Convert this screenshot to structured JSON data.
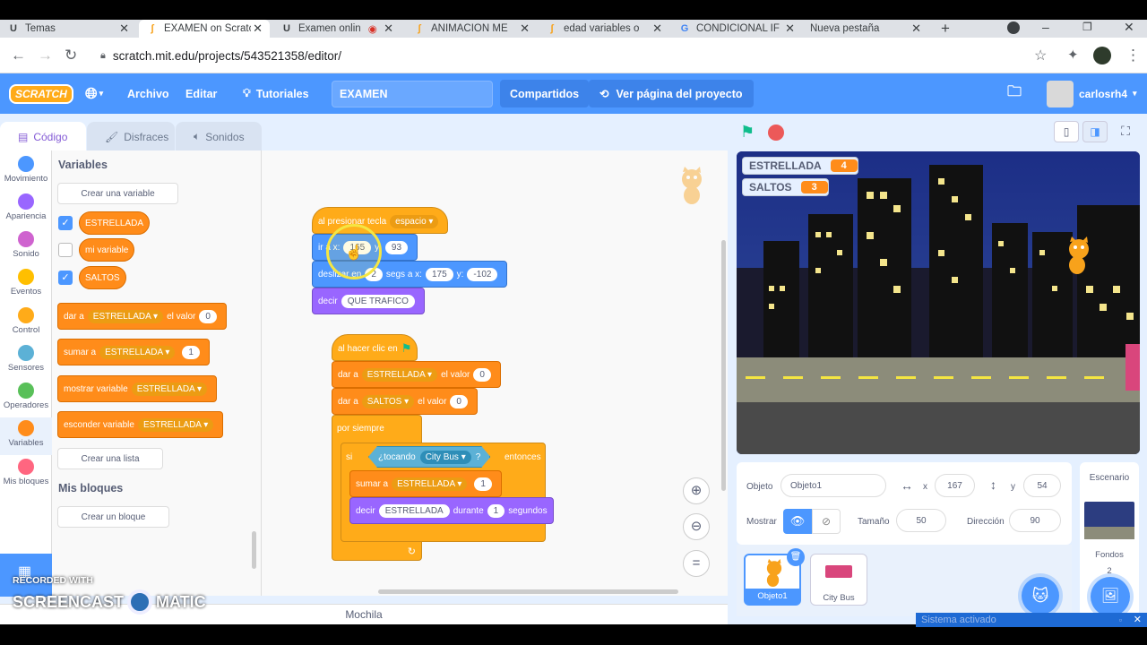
{
  "tabs": [
    {
      "label": "Temas",
      "icon": "u-logo-icon"
    },
    {
      "label": "EXAMEN on Scratch",
      "icon": "scratch-favicon-icon"
    },
    {
      "label": "Examen onlin",
      "icon": "u-logo-icon"
    },
    {
      "label": "ANIMACION ME",
      "icon": "scratch-favicon-icon"
    },
    {
      "label": "edad variables o",
      "icon": "scratch-favicon-icon"
    },
    {
      "label": "CONDICIONAL IF",
      "icon": "google-icon"
    },
    {
      "label": "Nueva pestaña",
      "icon": ""
    }
  ],
  "url": "scratch.mit.edu/projects/543521358/editor/",
  "menubar": {
    "logo": "SCRATCH",
    "archivo": "Archivo",
    "editar": "Editar",
    "tutoriales": "Tutoriales",
    "project_title": "EXAMEN",
    "compartidos": "Compartidos",
    "ver_pagina": "Ver página del proyecto",
    "username": "carlosrh4"
  },
  "editor_tabs": {
    "codigo": "Código",
    "disfraces": "Disfraces",
    "sonidos": "Sonidos"
  },
  "categories": [
    {
      "label": "Movimiento",
      "color": "#4c97ff"
    },
    {
      "label": "Apariencia",
      "color": "#9966ff"
    },
    {
      "label": "Sonido",
      "color": "#cf63cf"
    },
    {
      "label": "Eventos",
      "color": "#ffbf00"
    },
    {
      "label": "Control",
      "color": "#ffab19"
    },
    {
      "label": "Sensores",
      "color": "#5cb1d6"
    },
    {
      "label": "Operadores",
      "color": "#59c059"
    },
    {
      "label": "Variables",
      "color": "#ff8c1a"
    },
    {
      "label": "Mis bloques",
      "color": "#ff6680"
    }
  ],
  "palette": {
    "heading": "Variables",
    "create_var": "Crear una variable",
    "vars": [
      {
        "label": "ESTRELLADA",
        "checked": true
      },
      {
        "label": "mi variable",
        "checked": false
      },
      {
        "label": "SALTOS",
        "checked": true
      }
    ],
    "set": {
      "t1": "dar a",
      "var": "ESTRELLADA",
      "t2": "el valor",
      "val": "0"
    },
    "change": {
      "t1": "sumar a",
      "var": "ESTRELLADA",
      "val": "1"
    },
    "show": {
      "t1": "mostrar variable",
      "var": "ESTRELLADA"
    },
    "hide": {
      "t1": "esconder variable",
      "var": "ESTRELLADA"
    },
    "create_list": "Crear una lista",
    "myblocks_heading": "Mis bloques",
    "create_block": "Crear un bloque"
  },
  "script1": {
    "hat_t": "al presionar tecla",
    "hat_key": "espacio",
    "goto_t": "ir a x:",
    "goto_x": "165",
    "goto_y_t": "y:",
    "goto_y": "93",
    "glide_t": "deslizar en",
    "glide_s": "2",
    "glide_t2": "segs a x:",
    "glide_x": "175",
    "glide_y_t": "y:",
    "glide_y": "-102",
    "say_t": "decir",
    "say_v": "QUE TRAFICO"
  },
  "script2": {
    "hat_t": "al hacer clic en",
    "set1_t": "dar a",
    "set1_var": "ESTRELLADA",
    "set1_t2": "el valor",
    "set1_v": "0",
    "set2_t": "dar a",
    "set2_var": "SALTOS",
    "set2_t2": "el valor",
    "set2_v": "0",
    "forever": "por siempre",
    "if_t": "si",
    "touch_t": "¿tocando",
    "touch_obj": "City Bus",
    "if_q": "?",
    "if_then": "entonces",
    "change_t": "sumar a",
    "change_var": "ESTRELLADA",
    "change_v": "1",
    "say_t": "decir",
    "say_var": "ESTRELLADA",
    "say_t2": "durante",
    "say_secs": "1",
    "say_t3": "segundos"
  },
  "backpack": "Mochila",
  "monitors": [
    {
      "label": "ESTRELLADA",
      "value": "4"
    },
    {
      "label": "SALTOS",
      "value": "3"
    }
  ],
  "sprite_info": {
    "objeto_label": "Objeto",
    "objeto_val": "Objeto1",
    "x_label": "x",
    "x_val": "167",
    "y_label": "y",
    "y_val": "54",
    "mostrar": "Mostrar",
    "tamano_label": "Tamaño",
    "tamano_val": "50",
    "direccion_label": "Dirección",
    "direccion_val": "90"
  },
  "sprites": [
    {
      "label": "Objeto1",
      "selected": true
    },
    {
      "label": "City Bus",
      "selected": false
    }
  ],
  "stage_panel": {
    "title": "Escenario",
    "fondos": "Fondos",
    "fondos_count": "2"
  },
  "watermark": {
    "line1": "RECORDED WITH",
    "line2": "SCREENCAST",
    "line3": "MATIC"
  },
  "taskbar": "Sistema activado"
}
